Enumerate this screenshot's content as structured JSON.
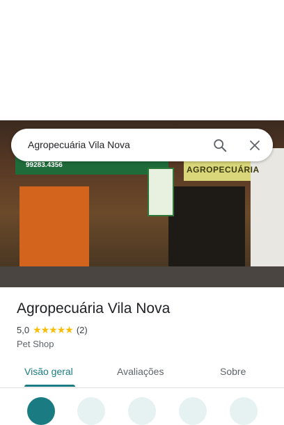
{
  "search": {
    "query": "Agropecuária Vila Nova"
  },
  "photo": {
    "phone_text": "99283.4356",
    "sign_text": "AGROPECUÁRIA"
  },
  "place": {
    "name": "Agropecuária Vila Nova",
    "rating": "5,0",
    "stars": "★★★★★",
    "review_count": "(2)",
    "category": "Pet Shop"
  },
  "tabs": [
    {
      "label": "Visão geral",
      "active": true
    },
    {
      "label": "Avaliações",
      "active": false
    },
    {
      "label": "Sobre",
      "active": false
    }
  ],
  "colors": {
    "accent": "#1a7b83",
    "star": "#fbbc04"
  },
  "actions": [
    {
      "icon": "directions-icon"
    },
    {
      "icon": "save-icon"
    },
    {
      "icon": "nearby-icon"
    },
    {
      "icon": "send-to-phone-icon"
    },
    {
      "icon": "share-icon"
    }
  ]
}
